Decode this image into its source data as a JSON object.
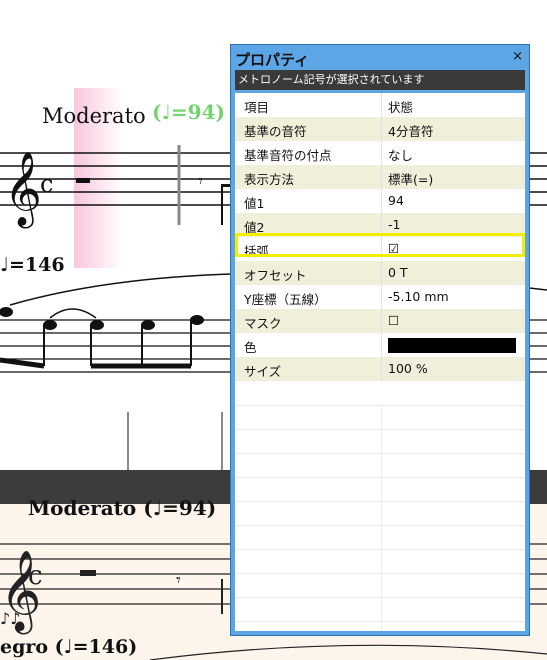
{
  "score": {
    "tempo_word": "Moderato",
    "tempo_mark": "(♩=94)",
    "tempo_left": "♩=146",
    "bottom_tempo_word": "Moderato (♩=94)",
    "bottom_tempo_left": "egro (♩=146)",
    "colors": {
      "tempo_mark": "#74d36e",
      "background_bottom": "#fdf4ec"
    }
  },
  "panel": {
    "title": "プロパティ",
    "close": "×",
    "status": "メトロノーム記号が選択されています",
    "header": {
      "col1": "項目",
      "col2": "状態"
    },
    "rows": [
      {
        "label": "基準の音符",
        "value": "4分音符"
      },
      {
        "label": "基準音符の付点",
        "value": "なし"
      },
      {
        "label": "表示方法",
        "value": "標準(=)"
      },
      {
        "label": "値1",
        "value": "94"
      },
      {
        "label": "値2",
        "value": "-1"
      },
      {
        "label": "括弧",
        "value": "☑"
      },
      {
        "label": "オフセット",
        "value": "0 T"
      },
      {
        "label": "Y座標（五線）",
        "value": "-5.10 mm"
      },
      {
        "label": "マスク",
        "value": "☐"
      },
      {
        "label": "色",
        "value": "#000000"
      },
      {
        "label": "サイズ",
        "value": "100 %"
      }
    ]
  }
}
